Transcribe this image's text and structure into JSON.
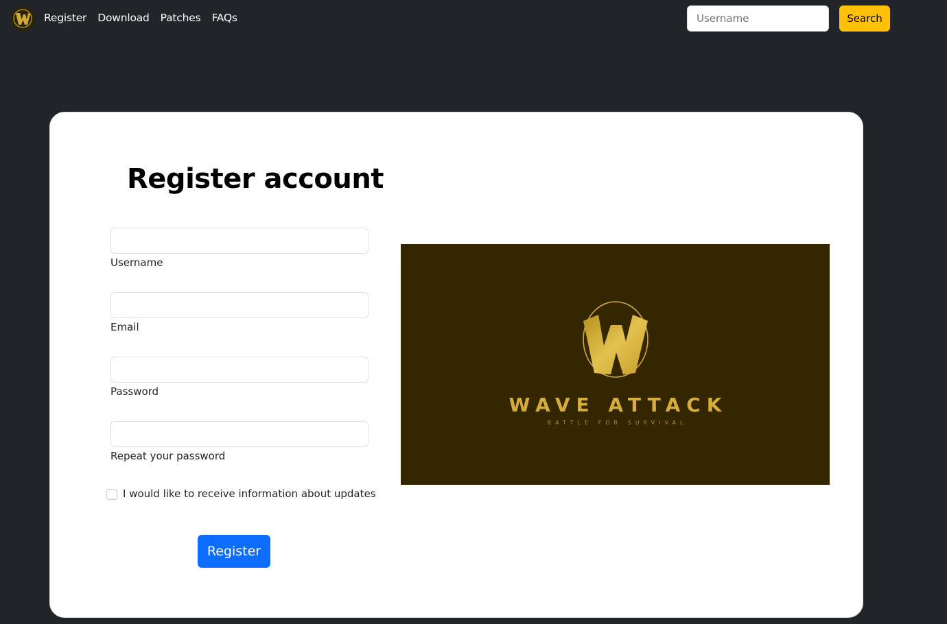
{
  "nav": {
    "brand_icon": "wave-attack-logo-icon",
    "links": [
      "Register",
      "Download",
      "Patches",
      "FAQs"
    ],
    "search": {
      "placeholder": "Username",
      "button_label": "Search"
    }
  },
  "form": {
    "title": "Register account",
    "fields": [
      {
        "label": "Username",
        "value": ""
      },
      {
        "label": "Email",
        "value": ""
      },
      {
        "label": "Password",
        "value": ""
      },
      {
        "label": "Repeat your password",
        "value": ""
      }
    ],
    "checkbox_label": "I would like to receive information about updates",
    "checkbox_checked": false,
    "submit_label": "Register"
  },
  "banner": {
    "title": "WAVE ATTACK",
    "tagline": "BATTLE FOR SURVIVAL"
  },
  "colors": {
    "page_bg": "#212529",
    "accent_button": "#ffc107",
    "primary_button": "#0d6efd",
    "banner_bg": "#342700",
    "gold": "#d4ad3a"
  }
}
